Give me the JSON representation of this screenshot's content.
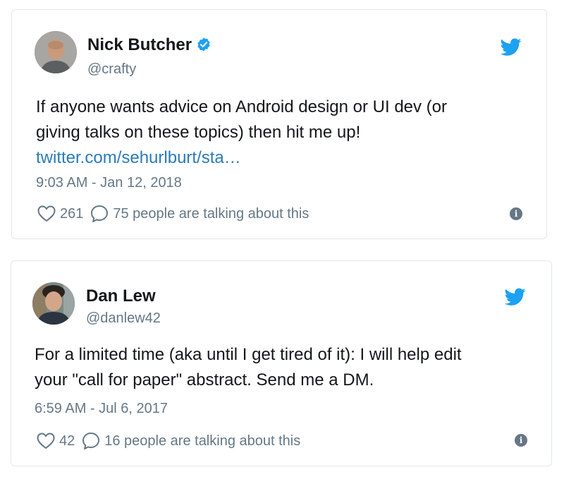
{
  "tweets": [
    {
      "author_name": "Nick Butcher",
      "verified": true,
      "handle": "@crafty",
      "text_line_1": "If anyone wants advice on Android design or UI dev (or",
      "text_line_2": "giving talks on these topics) then hit me up!",
      "link": "twitter.com/sehurlburt/sta…",
      "timestamp": "9:03 AM - Jan 12, 2018",
      "likes": "261",
      "replies_label": "75 people are talking about this",
      "icons": [
        "avatar",
        "verified-badge-icon",
        "twitter-bird-icon",
        "heart-icon",
        "reply-bubble-icon",
        "info-icon"
      ]
    },
    {
      "author_name": "Dan Lew",
      "verified": false,
      "handle": "@danlew42",
      "text_line_1": "For a limited time (aka until I get tired of it): I will help edit",
      "text_line_2": "your \"call for paper\" abstract. Send me a DM.",
      "timestamp": "6:59 AM - Jul 6, 2017",
      "likes": "42",
      "replies_label": "16 people are talking about this",
      "icons": [
        "avatar",
        "twitter-bird-icon",
        "heart-icon",
        "reply-bubble-icon",
        "info-icon"
      ]
    }
  ],
  "info_glyph": "i",
  "colors": {
    "text": "#14171a",
    "secondary": "#657786",
    "link": "#2b7bb9",
    "twitter_blue": "#1da1f2",
    "border": "#e1e8ed"
  }
}
